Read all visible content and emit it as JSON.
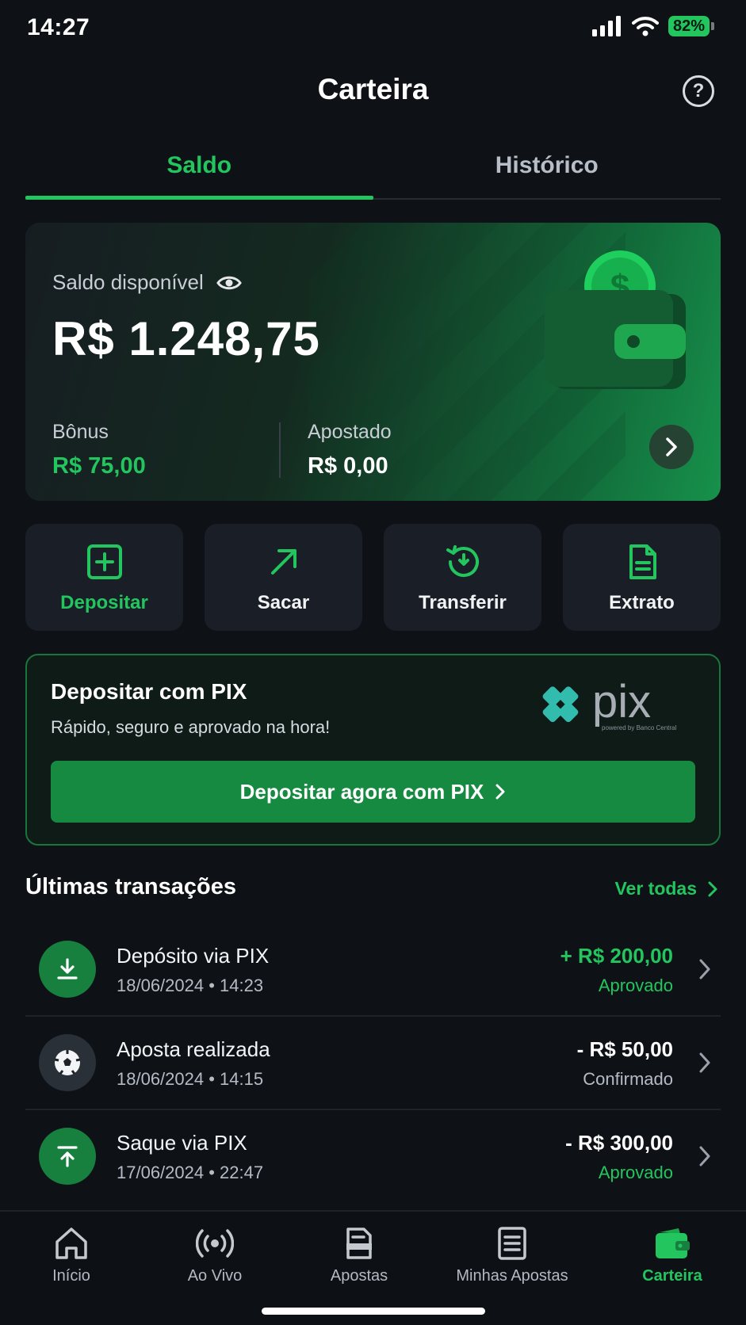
{
  "status_bar": {
    "time": "14:27",
    "battery": "82%"
  },
  "header": {
    "title": "Carteira",
    "help_icon": "help-circle-icon"
  },
  "tabs": [
    {
      "label": "Saldo",
      "active": true
    },
    {
      "label": "Histórico",
      "active": false
    }
  ],
  "balance": {
    "label": "Saldo disponível",
    "value": "R$ 1.248,75",
    "bonus_label": "Bônus",
    "bonus_value": "R$ 75,00",
    "bet_label": "Apostado",
    "bet_value": "R$ 0,00"
  },
  "actions": [
    {
      "label": "Depositar",
      "icon": "plus-square-icon"
    },
    {
      "label": "Sacar",
      "icon": "arrow-up-right-icon"
    },
    {
      "label": "Transferir",
      "icon": "history-icon"
    },
    {
      "label": "Extrato",
      "icon": "document-icon"
    }
  ],
  "pix": {
    "title": "Depositar com PIX",
    "subtitle": "Rápido, seguro e aprovado na hora!",
    "logo_text": "pix",
    "logo_caption": "powered by Banco Central",
    "button": "Depositar agora com PIX"
  },
  "transactions": {
    "title": "Últimas transações",
    "see_all": "Ver todas",
    "items": [
      {
        "name": "Depósito via PIX",
        "date": "18/06/2024 • 14:23",
        "amount": "+ R$ 200,00",
        "status": "Aprovado",
        "icon": "download-icon"
      },
      {
        "name": "Aposta realizada",
        "date": "18/06/2024 • 14:15",
        "amount": "- R$ 50,00",
        "status": "Confirmado",
        "icon": "soccer-ball-icon"
      },
      {
        "name": "Saque via PIX",
        "date": "17/06/2024 • 22:47",
        "amount": "- R$ 300,00",
        "status": "Aprovado",
        "icon": "upload-icon"
      }
    ]
  },
  "bottom_nav": [
    {
      "label": "Início",
      "icon": "home-icon"
    },
    {
      "label": "Ao Vivo",
      "icon": "live-broadcast-icon"
    },
    {
      "label": "Apostas",
      "icon": "ticket-icon"
    },
    {
      "label": "Minhas Apostas",
      "icon": "list-document-icon"
    },
    {
      "label": "Carteira",
      "icon": "wallet-icon",
      "active": true
    }
  ],
  "colors": {
    "accent": "#22c55e",
    "background": "#0e1217",
    "card": "#1a1f27"
  }
}
